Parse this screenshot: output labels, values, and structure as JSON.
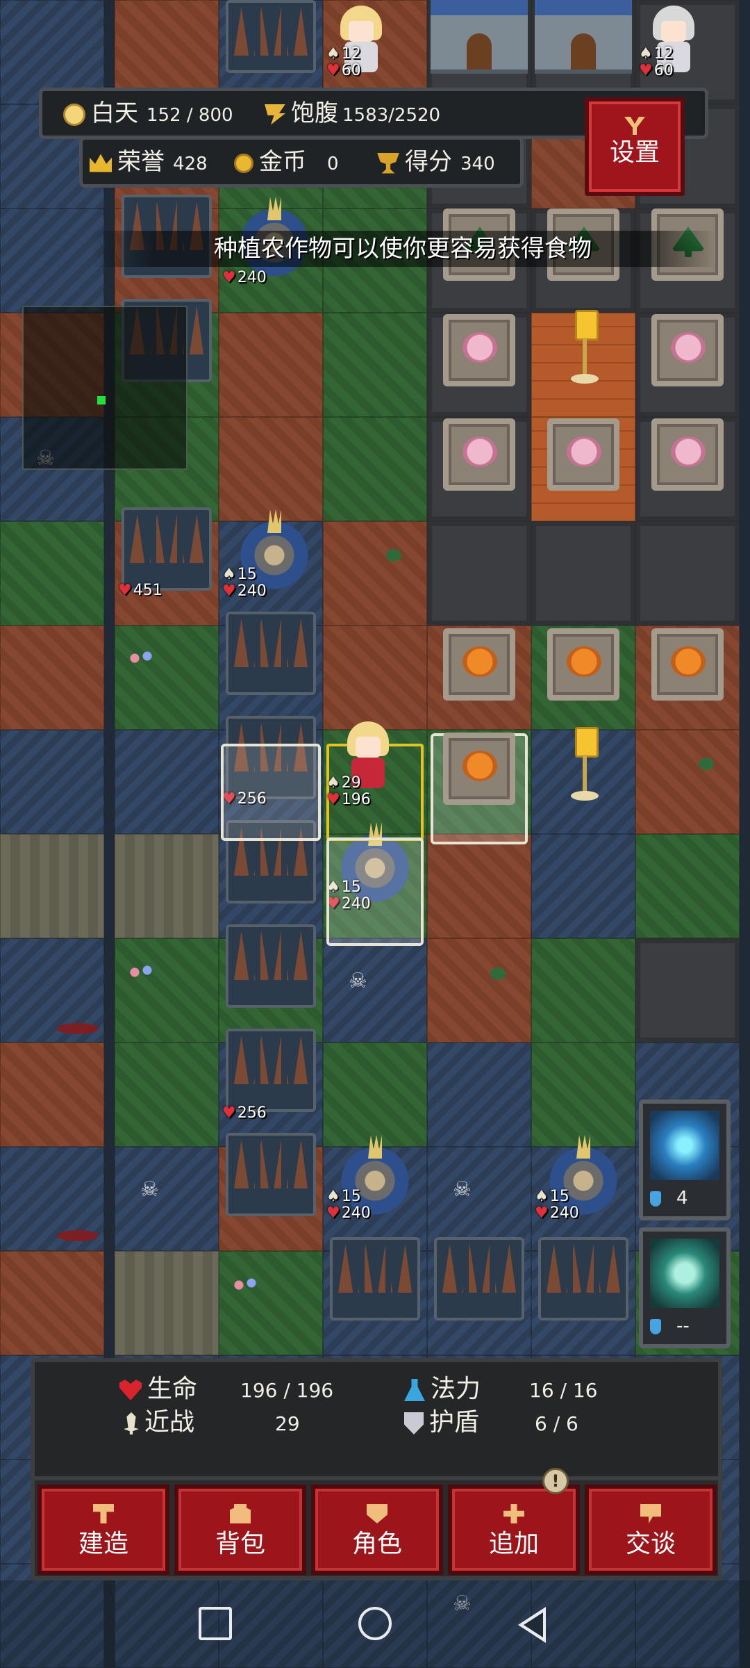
{
  "hud": {
    "day_label": "白天",
    "day_value": "152 / 800",
    "hunger_label": "饱腹",
    "hunger_value": "1583/2520",
    "honor_label": "荣誉",
    "honor_value": "428",
    "gold_label": "金币",
    "gold_value": "0",
    "score_label": "得分",
    "score_value": "340",
    "settings_label": "设置"
  },
  "tip": "种植农作物可以使你更容易获得食物",
  "board_units": {
    "angel_top": {
      "atk": "12",
      "hp": "60"
    },
    "knight_top": {
      "atk": "12",
      "hp": "60"
    },
    "tower_1": {
      "hp": "240"
    },
    "spikes_451": {
      "hp": "451"
    },
    "tower_2": {
      "atk": "15",
      "hp": "240"
    },
    "spikes_256a": {
      "hp": "256"
    },
    "hero": {
      "atk": "29",
      "hp": "196"
    },
    "tower_3": {
      "atk": "15",
      "hp": "240"
    },
    "spikes_256b": {
      "hp": "256"
    },
    "tower_4": {
      "atk": "15",
      "hp": "240"
    },
    "tower_5": {
      "atk": "15",
      "hp": "240"
    }
  },
  "skills": [
    {
      "name": "lightning",
      "cost": "4"
    },
    {
      "name": "shield",
      "cost": "--"
    }
  ],
  "stats": {
    "hp_label": "生命",
    "hp_value": "196 / 196",
    "mana_label": "法力",
    "mana_value": "16  /  16",
    "melee_label": "近战",
    "melee_value": "29",
    "shield_label": "护盾",
    "shield_value": "6  /  6"
  },
  "actions": [
    {
      "label": "建造",
      "icon": "hammer-icon"
    },
    {
      "label": "背包",
      "icon": "bag-icon"
    },
    {
      "label": "角色",
      "icon": "character-icon"
    },
    {
      "label": "追加",
      "icon": "plus-icon",
      "badge": "!"
    },
    {
      "label": "交谈",
      "icon": "chat-icon"
    }
  ],
  "colors": {
    "button_red": "#9b151a",
    "heart_red": "#d9232d",
    "mana_blue": "#3aa6e0",
    "minimap_player": "#24e03d"
  }
}
